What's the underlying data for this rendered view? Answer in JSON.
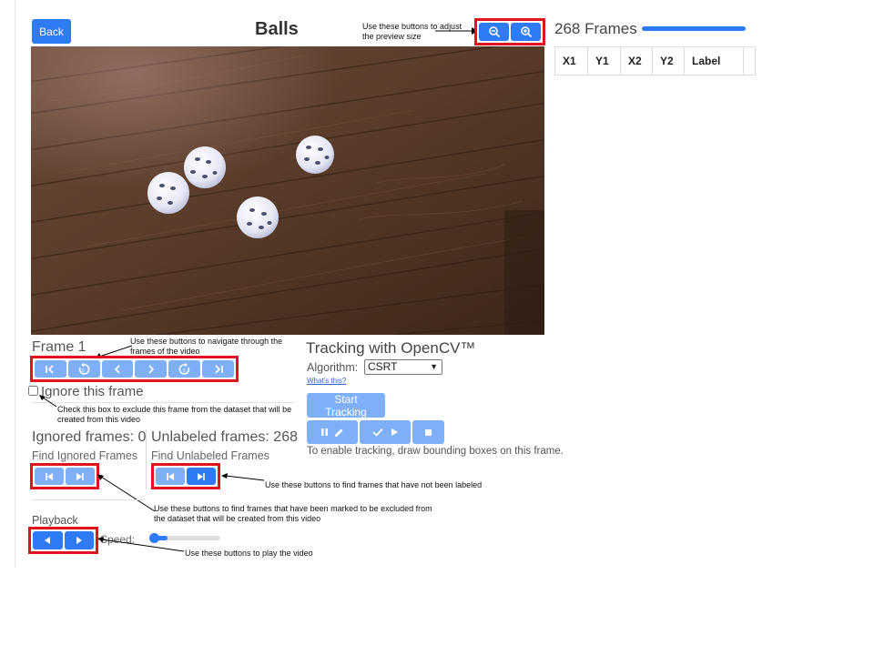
{
  "header": {
    "back_label": "Back",
    "title": "Balls",
    "zoom_note": "Use these buttons to adjust the preview  size",
    "frames_count": "268 Frames"
  },
  "table": {
    "columns": [
      "X1",
      "Y1",
      "X2",
      "Y2",
      "Label",
      ""
    ]
  },
  "frame": {
    "label": "Frame 1",
    "nav_note": "Use these buttons to navigate through the frames of the video",
    "ignore_label": "Ignore this frame",
    "ignore_note": "Check this box to exclude this frame from the dataset that will be created from this video"
  },
  "tracking": {
    "title": "Tracking with OpenCV™",
    "algorithm_label": "Algorithm:",
    "algorithm_value": "CSRT",
    "whats_this": "What's this?",
    "start_label": "Start Tracking",
    "hint": "To enable tracking, draw bounding boxes on this frame."
  },
  "ignored": {
    "title": "Ignored frames: 0",
    "find_label": "Find Ignored Frames",
    "note": "Use these buttons to find frames that have been marked to be excluded from the dataset that will be created from this video"
  },
  "unlabeled": {
    "title": "Unlabeled frames: 268",
    "find_label": "Find Unlabeled Frames",
    "note": "Use these buttons to find frames that have not been labeled"
  },
  "playback": {
    "title": "Playback",
    "speed_label": "Speed:",
    "note": "Use these buttons to play the video"
  },
  "colors": {
    "accent": "#2f7bf5",
    "accent_light": "#7fb0f7",
    "annotation_red": "#e0141e"
  },
  "icons": [
    "back-icon",
    "zoom-out-icon",
    "zoom-in-icon",
    "first-frame-icon",
    "rewind-icon",
    "prev-icon",
    "next-icon",
    "forward-icon",
    "last-frame-icon",
    "pause-icon",
    "edit-icon",
    "check-icon",
    "play-icon",
    "stop-icon",
    "skip-prev-icon",
    "skip-next-icon"
  ]
}
